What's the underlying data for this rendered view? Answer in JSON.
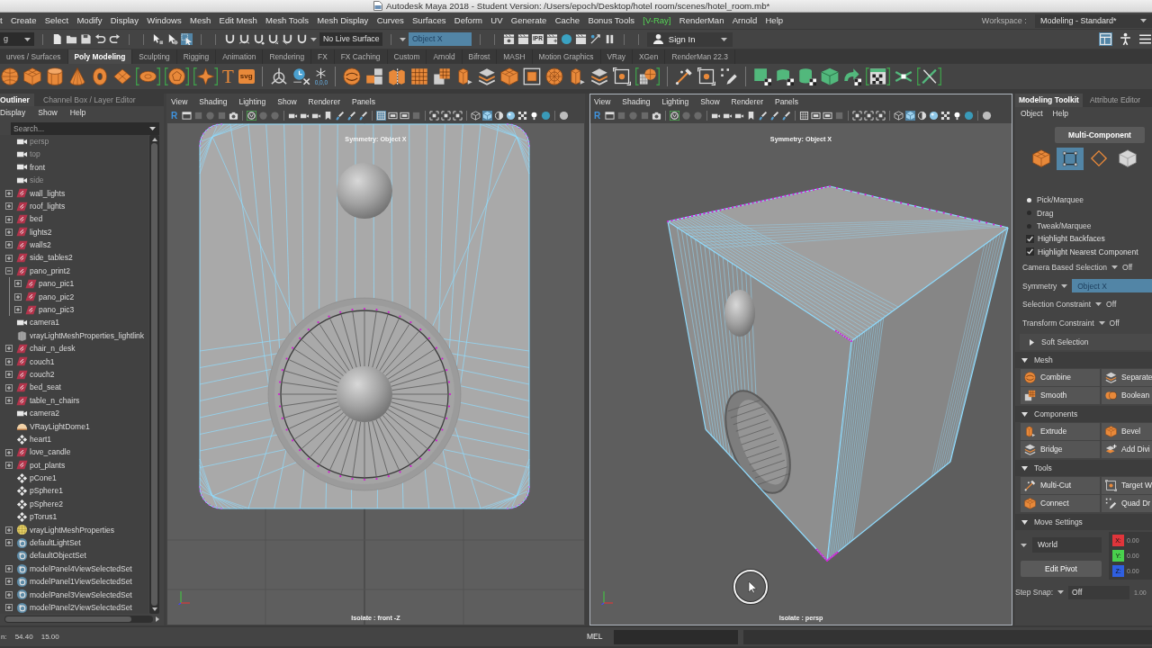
{
  "window": {
    "title": "Autodesk Maya 2018 - Student Version: /Users/epoch/Desktop/hotel room/scenes/hotel_room.mb*"
  },
  "menu_bar": {
    "items": [
      {
        "label": "t",
        "kind": "menu"
      },
      {
        "label": "Create",
        "kind": "menu"
      },
      {
        "label": "Select",
        "kind": "menu"
      },
      {
        "label": "Modify",
        "kind": "menu"
      },
      {
        "label": "Display",
        "kind": "menu"
      },
      {
        "label": "Windows",
        "kind": "menu"
      },
      {
        "label": "Mesh",
        "kind": "menu"
      },
      {
        "label": "Edit Mesh",
        "kind": "menu"
      },
      {
        "label": "Mesh Tools",
        "kind": "menu"
      },
      {
        "label": "Mesh Display",
        "kind": "menu"
      },
      {
        "label": "Curves",
        "kind": "menu"
      },
      {
        "label": "Surfaces",
        "kind": "menu"
      },
      {
        "label": "Deform",
        "kind": "menu"
      },
      {
        "label": "UV",
        "kind": "menu"
      },
      {
        "label": "Generate",
        "kind": "menu"
      },
      {
        "label": "Cache",
        "kind": "menu"
      },
      {
        "label": "Bonus Tools",
        "kind": "menu"
      },
      {
        "label": "[V-Ray]",
        "kind": "plugin"
      },
      {
        "label": "RenderMan",
        "kind": "menu"
      },
      {
        "label": "Arnold",
        "kind": "menu"
      },
      {
        "label": "Help",
        "kind": "menu"
      }
    ],
    "workspace_label": "Workspace :",
    "workspace": "Modeling - Standard*"
  },
  "status_line": {
    "menu_set": "g",
    "select_modes": [
      {
        "selected": false
      },
      {
        "selected": false
      },
      {
        "selected": true
      }
    ],
    "live_surface": "No Live Surface",
    "symmetry": "Object X",
    "ipr_label": "IPR",
    "sign_in": "Sign In",
    "panel_toggles": [
      {
        "selected": true
      },
      {
        "selected": false
      },
      {
        "selected": false
      }
    ]
  },
  "shelf": {
    "tabs": [
      {
        "label": "urves / Surfaces",
        "selected": false
      },
      {
        "label": "Poly Modeling",
        "selected": true
      },
      {
        "label": "Sculpting",
        "selected": false
      },
      {
        "label": "Rigging",
        "selected": false
      },
      {
        "label": "Animation",
        "selected": false
      },
      {
        "label": "Rendering",
        "selected": false
      },
      {
        "label": "FX",
        "selected": false
      },
      {
        "label": "FX Caching",
        "selected": false
      },
      {
        "label": "Custom",
        "selected": false
      },
      {
        "label": "Arnold",
        "selected": false
      },
      {
        "label": "Bifrost",
        "selected": false
      },
      {
        "label": "MASH",
        "selected": false
      },
      {
        "label": "Motion Graphics",
        "selected": false
      },
      {
        "label": "VRay",
        "selected": false
      },
      {
        "label": "XGen",
        "selected": false
      },
      {
        "label": "RenderMan 22.3",
        "selected": false
      }
    ],
    "text_tool": "T",
    "svg_tool": "svg",
    "reset_label": "0,0,0"
  },
  "outliner": {
    "tabs": [
      {
        "label": "Outliner",
        "selected": true
      },
      {
        "label": "Channel Box / Layer Editor",
        "selected": false
      }
    ],
    "menu": [
      "Display",
      "Show",
      "Help"
    ],
    "search": {
      "placeholder": "Search..."
    },
    "items": [
      {
        "label": "persp",
        "kind": "camera",
        "hidden": true
      },
      {
        "label": "top",
        "kind": "camera",
        "hidden": true
      },
      {
        "label": "front",
        "kind": "camera",
        "hidden": false
      },
      {
        "label": "side",
        "kind": "camera",
        "hidden": true
      },
      {
        "label": "wall_lights",
        "kind": "group",
        "hidden": false,
        "expanded": false
      },
      {
        "label": "roof_lights",
        "kind": "group",
        "hidden": false,
        "expanded": false
      },
      {
        "label": "bed",
        "kind": "group",
        "hidden": false,
        "expanded": false
      },
      {
        "label": "lights2",
        "kind": "group",
        "hidden": false,
        "expanded": false
      },
      {
        "label": "walls2",
        "kind": "group",
        "hidden": false,
        "expanded": false
      },
      {
        "label": "side_tables2",
        "kind": "group",
        "hidden": false,
        "expanded": false
      },
      {
        "label": "pano_print2",
        "kind": "group",
        "hidden": false,
        "expanded": true,
        "children": [
          {
            "label": "pano_pic1",
            "kind": "group",
            "hidden": false,
            "expanded": false
          },
          {
            "label": "pano_pic2",
            "kind": "group",
            "hidden": false,
            "expanded": false
          },
          {
            "label": "pano_pic3",
            "kind": "group",
            "hidden": false,
            "expanded": false
          }
        ]
      },
      {
        "label": "camera1",
        "kind": "camera",
        "hidden": false
      },
      {
        "label": "vrayLightMeshProperties_lightlink",
        "kind": "lightlink",
        "hidden": false
      },
      {
        "label": "chair_n_desk",
        "kind": "group",
        "hidden": false,
        "expanded": false
      },
      {
        "label": "couch1",
        "kind": "group",
        "hidden": false,
        "expanded": false
      },
      {
        "label": "couch2",
        "kind": "group",
        "hidden": false,
        "expanded": false
      },
      {
        "label": "bed_seat",
        "kind": "group",
        "hidden": false,
        "expanded": false
      },
      {
        "label": "table_n_chairs",
        "kind": "group",
        "hidden": false,
        "expanded": false
      },
      {
        "label": "camera2",
        "kind": "camera",
        "hidden": false
      },
      {
        "label": "VRayLightDome1",
        "kind": "dome",
        "hidden": false
      },
      {
        "label": "heart1",
        "kind": "mesh",
        "hidden": false
      },
      {
        "label": "love_candle",
        "kind": "group",
        "hidden": false,
        "expanded": false
      },
      {
        "label": "pot_plants",
        "kind": "group",
        "hidden": false,
        "expanded": false
      },
      {
        "label": "pCone1",
        "kind": "mesh",
        "hidden": false
      },
      {
        "label": "pSphere1",
        "kind": "mesh",
        "hidden": false
      },
      {
        "label": "pSphere2",
        "kind": "mesh",
        "hidden": false
      },
      {
        "label": "pTorus1",
        "kind": "mesh",
        "hidden": false
      },
      {
        "label": "vrayLightMeshProperties",
        "kind": "lightmesh",
        "hidden": false,
        "expanded": false
      },
      {
        "label": "defaultLightSet",
        "kind": "set",
        "hidden": false,
        "expanded": false
      },
      {
        "label": "defaultObjectSet",
        "kind": "set",
        "hidden": false
      },
      {
        "label": "modelPanel4ViewSelectedSet",
        "kind": "set",
        "hidden": false,
        "expanded": false
      },
      {
        "label": "modelPanel1ViewSelectedSet",
        "kind": "set",
        "hidden": false,
        "expanded": false
      },
      {
        "label": "modelPanel3ViewSelectedSet",
        "kind": "set",
        "hidden": false,
        "expanded": false
      },
      {
        "label": "modelPanel2ViewSelectedSet",
        "kind": "set",
        "hidden": false,
        "expanded": false
      }
    ]
  },
  "viewports": [
    {
      "kind": "front",
      "active": false,
      "menu": [
        "View",
        "Shading",
        "Lighting",
        "Show",
        "Renderer",
        "Panels"
      ],
      "renderer_letter": "R",
      "tools": [
        {
          "selected": false
        },
        {
          "selected": false
        },
        {
          "selected": false
        },
        {
          "selected": false
        },
        {
          "selected": false
        },
        {
          "selected": true
        },
        {
          "selected": false
        },
        {
          "selected": false
        },
        {
          "selected": false
        },
        {
          "selected": false
        },
        {
          "selected": false
        },
        {
          "selected": false
        },
        {
          "selected": false
        },
        {
          "selected": false
        },
        {
          "selected": false
        },
        {
          "selected": true
        },
        {
          "selected": false
        },
        {
          "selected": false
        },
        {
          "selected": false
        },
        {
          "selected": false
        },
        {
          "selected": false
        },
        {
          "selected": false
        },
        {
          "selected": false
        },
        {
          "selected": true
        },
        {
          "selected": false
        },
        {
          "selected": false
        },
        {
          "selected": false
        },
        {
          "selected": false
        },
        {
          "selected": false
        },
        {
          "selected": false
        }
      ],
      "symmetry": "Symmetry: Object X",
      "isolate": "Isolate : front -Z"
    },
    {
      "kind": "persp",
      "active": true,
      "menu": [
        "View",
        "Shading",
        "Lighting",
        "Show",
        "Renderer",
        "Panels"
      ],
      "renderer_letter": "R",
      "tools": [
        {
          "selected": false
        },
        {
          "selected": false
        },
        {
          "selected": false
        },
        {
          "selected": false
        },
        {
          "selected": false
        },
        {
          "selected": true
        },
        {
          "selected": false
        },
        {
          "selected": false
        },
        {
          "selected": false
        },
        {
          "selected": false
        },
        {
          "selected": false
        },
        {
          "selected": false
        },
        {
          "selected": false
        },
        {
          "selected": false
        },
        {
          "selected": false
        },
        {
          "selected": false
        },
        {
          "selected": false
        },
        {
          "selected": false
        },
        {
          "selected": false
        },
        {
          "selected": false
        },
        {
          "selected": false
        },
        {
          "selected": false
        },
        {
          "selected": false
        },
        {
          "selected": true
        },
        {
          "selected": false
        },
        {
          "selected": false
        },
        {
          "selected": false
        },
        {
          "selected": false
        },
        {
          "selected": false
        },
        {
          "selected": false
        }
      ],
      "symmetry": "Symmetry: Object X",
      "isolate": "Isolate : persp"
    }
  ],
  "toolkit": {
    "tabs": [
      {
        "label": "Modeling Toolkit",
        "selected": true
      },
      {
        "label": "Attribute Editor",
        "selected": false
      }
    ],
    "menu": [
      "Object",
      "Help"
    ],
    "mode_button": "Multi-Component",
    "component_modes": [
      {
        "kind": "object",
        "selected": false
      },
      {
        "kind": "multi",
        "selected": true
      },
      {
        "kind": "edge",
        "selected": false
      },
      {
        "kind": "face",
        "selected": false
      }
    ],
    "pick_styles": [
      {
        "label": "Pick/Marquee",
        "selected": true
      },
      {
        "label": "Drag",
        "selected": false
      },
      {
        "label": "Tweak/Marquee",
        "selected": false
      }
    ],
    "options": [
      {
        "label": "Highlight Backfaces",
        "checked": true
      },
      {
        "label": "Highlight Nearest Component",
        "checked": true
      }
    ],
    "settings": [
      {
        "label": "Camera Based Selection",
        "value": "Off",
        "highlighted": false
      },
      {
        "label": "Symmetry",
        "value": "Object X",
        "highlighted": true
      },
      {
        "label": "Selection Constraint",
        "value": "Off",
        "highlighted": false
      },
      {
        "label": "Transform Constraint",
        "value": "Off",
        "highlighted": false
      }
    ],
    "sections": [
      {
        "title": "Soft Selection",
        "expanded": false
      },
      {
        "title": "Mesh",
        "expanded": true,
        "buttons": [
          "Combine",
          "Separate",
          "Smooth",
          "Boolean"
        ]
      },
      {
        "title": "Components",
        "expanded": true,
        "buttons": [
          "Extrude",
          "Bevel",
          "Bridge",
          "Add Divi"
        ]
      },
      {
        "title": "Tools",
        "expanded": true,
        "buttons": [
          "Multi-Cut",
          "Target W",
          "Connect",
          "Quad Dr"
        ]
      },
      {
        "title": "Move Settings",
        "expanded": true,
        "space": "World",
        "pivot_button": "Edit Pivot",
        "axes": [
          {
            "label": "X:",
            "value": "0.00",
            "color": "#e0353b"
          },
          {
            "label": "Y:",
            "value": "0.00",
            "color": "#49d14d"
          },
          {
            "label": "Z:",
            "value": "0.00",
            "color": "#2f5fe0"
          }
        ],
        "step_snap": {
          "label": "Step Snap:",
          "value": "Off",
          "amount": "1.00"
        }
      }
    ]
  },
  "status_bar": {
    "label": "n:",
    "values": [
      "54.40",
      "15.00"
    ],
    "language": "MEL"
  }
}
